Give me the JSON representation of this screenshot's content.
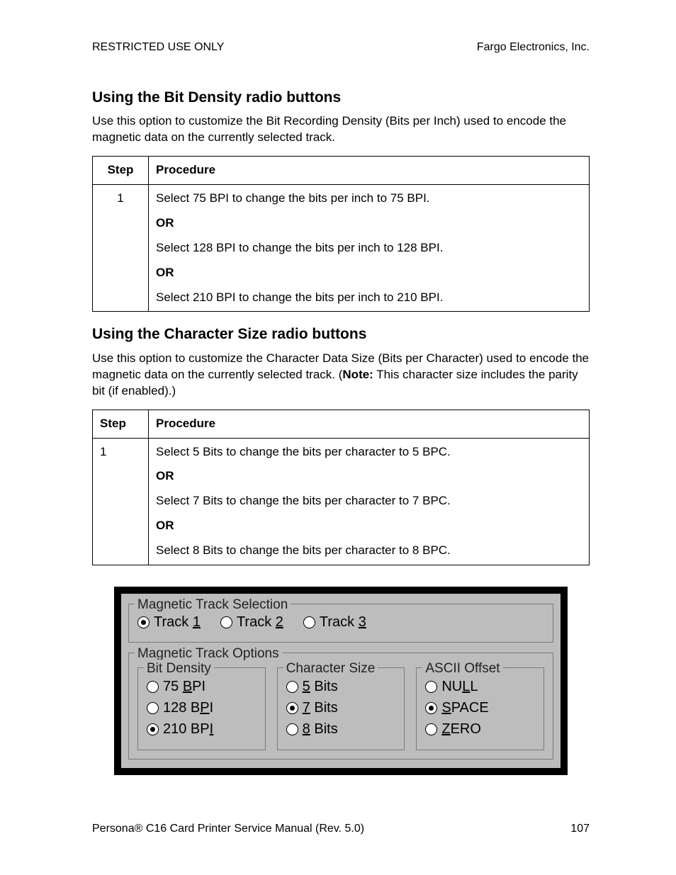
{
  "header": {
    "left": "RESTRICTED USE ONLY",
    "right": "Fargo Electronics, Inc."
  },
  "s1": {
    "title": "Using the Bit Density radio buttons",
    "intro": "Use this option to customize the Bit Recording Density (Bits per Inch) used to encode the magnetic data on the currently selected track.",
    "th_step": "Step",
    "th_proc": "Procedure",
    "step": "1",
    "p1": "Select 75 BPI to change the bits per inch to 75 BPI.",
    "or": "OR",
    "p2": "Select 128 BPI to change the bits per inch to 128 BPI.",
    "p3": "Select 210 BPI to change the bits per inch to 210 BPI."
  },
  "s2": {
    "title": "Using the Character Size radio buttons",
    "intro_a": "Use this option to customize the Character Data Size (Bits per Character) used to encode the magnetic data on the currently selected track. (",
    "intro_note": "Note:",
    "intro_b": "  This character size includes the parity bit (if enabled).)",
    "th_step": "Step",
    "th_proc": "Procedure",
    "step": "1",
    "p1": "Select 5 Bits to change the bits per character to 5 BPC.",
    "or": "OR",
    "p2": "Select 7 Bits to change the bits per character to 7 BPC.",
    "p3": "Select 8 Bits to change the bits per character to 8 BPC."
  },
  "dlg": {
    "grp_sel": "Magnetic Track Selection",
    "t1a": "Track ",
    "t1u": "1",
    "t2a": "Track ",
    "t2u": "2",
    "t3a": "Track ",
    "t3u": "3",
    "grp_opt": "Magnetic Track Options",
    "grp_bd": "Bit Density",
    "bd1a": "  75 ",
    "bd1u": "B",
    "bd1b": "PI",
    "bd2a": "128 B",
    "bd2u": "P",
    "bd2b": "I",
    "bd3a": "210 BP",
    "bd3u": "I",
    "bd3b": "",
    "grp_cs": "Character Size",
    "cs1u": "5",
    "cs1b": " Bits",
    "cs2u": "7",
    "cs2b": " Bits",
    "cs3u": "8",
    "cs3b": " Bits",
    "grp_ao": "ASCII Offset",
    "ao1a": "NU",
    "ao1u": "L",
    "ao1b": "L",
    "ao2u": "S",
    "ao2b": "PACE",
    "ao3u": "Z",
    "ao3b": "ERO"
  },
  "footer": {
    "left": "Persona® C16 Card Printer Service Manual (Rev. 5.0)",
    "right": "107"
  }
}
